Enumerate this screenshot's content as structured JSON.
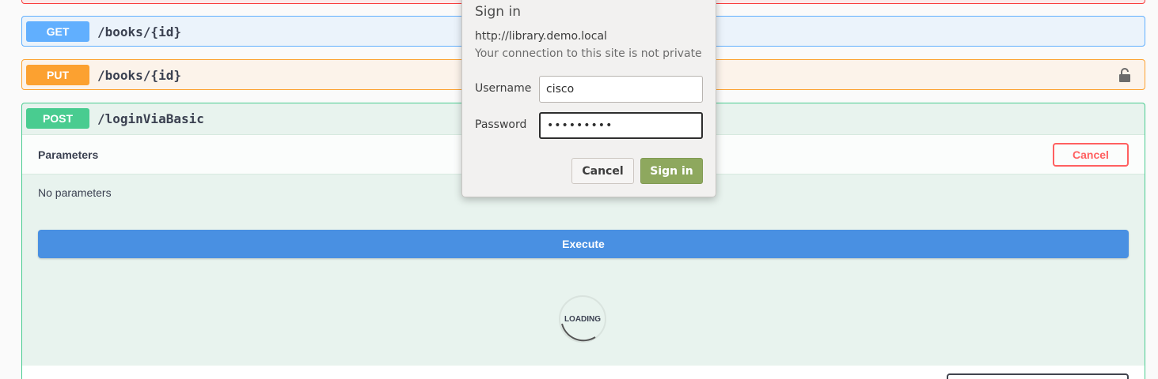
{
  "operations": {
    "get": {
      "method": "GET",
      "path": "/books/{id}"
    },
    "put": {
      "method": "PUT",
      "path": "/books/{id}"
    },
    "post": {
      "method": "POST",
      "path": "/loginViaBasic",
      "parameters_title": "Parameters",
      "cancel_label": "Cancel",
      "no_parameters": "No parameters",
      "execute_label": "Execute",
      "loading_text": "LOADING"
    }
  },
  "icons": {
    "lock": "lock-icon"
  },
  "dialog": {
    "title": "Sign in",
    "url": "http://library.demo.local",
    "warning": "Your connection to this site is not private",
    "username_label": "Username",
    "username_value": "cisco",
    "password_label": "Password",
    "password_value": "•••••••••",
    "cancel_label": "Cancel",
    "signin_label": "Sign in"
  },
  "colors": {
    "get": "#61affe",
    "put": "#fca130",
    "post": "#49cc90",
    "delete": "#f93e3e",
    "execute": "#4990e2",
    "signin": "#8ea85e"
  }
}
